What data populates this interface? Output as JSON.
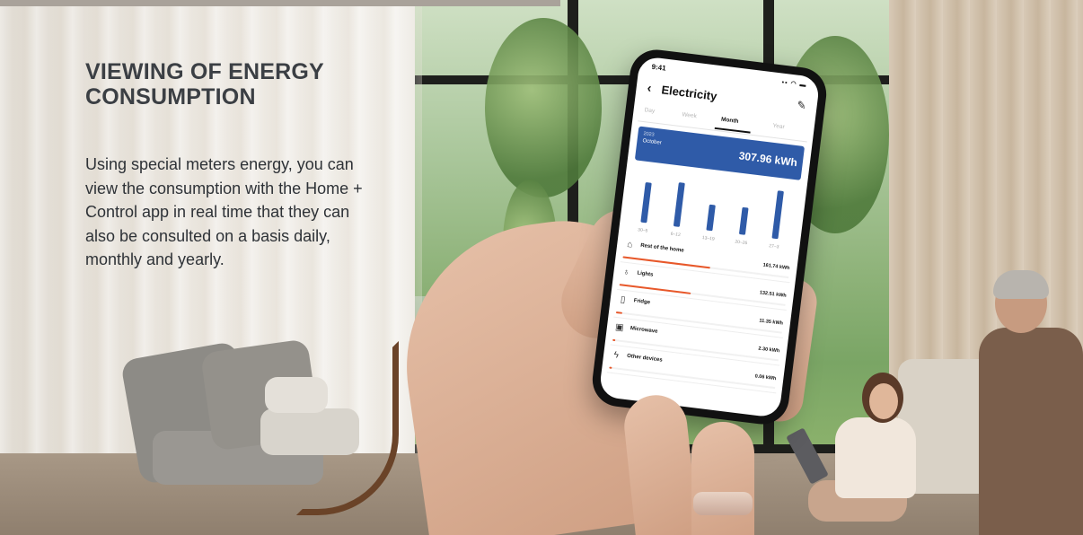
{
  "headline": "VIEWING OF ENERGY CONSUMPTION",
  "description": "Using special meters energy, you can view the consumption with the Home + Control app in real time that they can also be consulted on a basis daily, monthly and yearly.",
  "phone": {
    "status_time": "9:41",
    "status_icons": "▪▪ ◠ ▬",
    "title": "Electricity",
    "tabs": [
      {
        "label": "Day",
        "active": false
      },
      {
        "label": "Week",
        "active": false
      },
      {
        "label": "Month",
        "active": true
      },
      {
        "label": "Year",
        "active": false
      }
    ],
    "summary": {
      "year": "2023",
      "month": "October",
      "total": "307.96 kWh"
    },
    "accent_color": "#2f5ba8",
    "bar_color": "#e8582a",
    "devices": [
      {
        "icon": "home-icon",
        "glyph": "⌂",
        "name": "Rest of the home",
        "value": "161.74 kWh",
        "share": 0.525
      },
      {
        "icon": "bulb-icon",
        "glyph": "♁",
        "name": "Lights",
        "value": "132.51 kWh",
        "share": 0.43
      },
      {
        "icon": "fridge-icon",
        "glyph": "▯",
        "name": "Fridge",
        "value": "11.35 kWh",
        "share": 0.037
      },
      {
        "icon": "microwave-icon",
        "glyph": "▣",
        "name": "Microwave",
        "value": "2.30 kWh",
        "share": 0.008
      },
      {
        "icon": "plug-icon",
        "glyph": "ϟ",
        "name": "Other devices",
        "value": "0.06 kWh",
        "share": 0.002
      }
    ]
  },
  "chart_data": {
    "type": "bar",
    "categories": [
      "30–5",
      "6–12",
      "13–19",
      "20–26",
      "27–3"
    ],
    "values": [
      62,
      68,
      40,
      42,
      74
    ],
    "title": "",
    "xlabel": "",
    "ylabel": "",
    "ylim": [
      0,
      80
    ],
    "color": "#2f5ba8",
    "grid": false
  }
}
